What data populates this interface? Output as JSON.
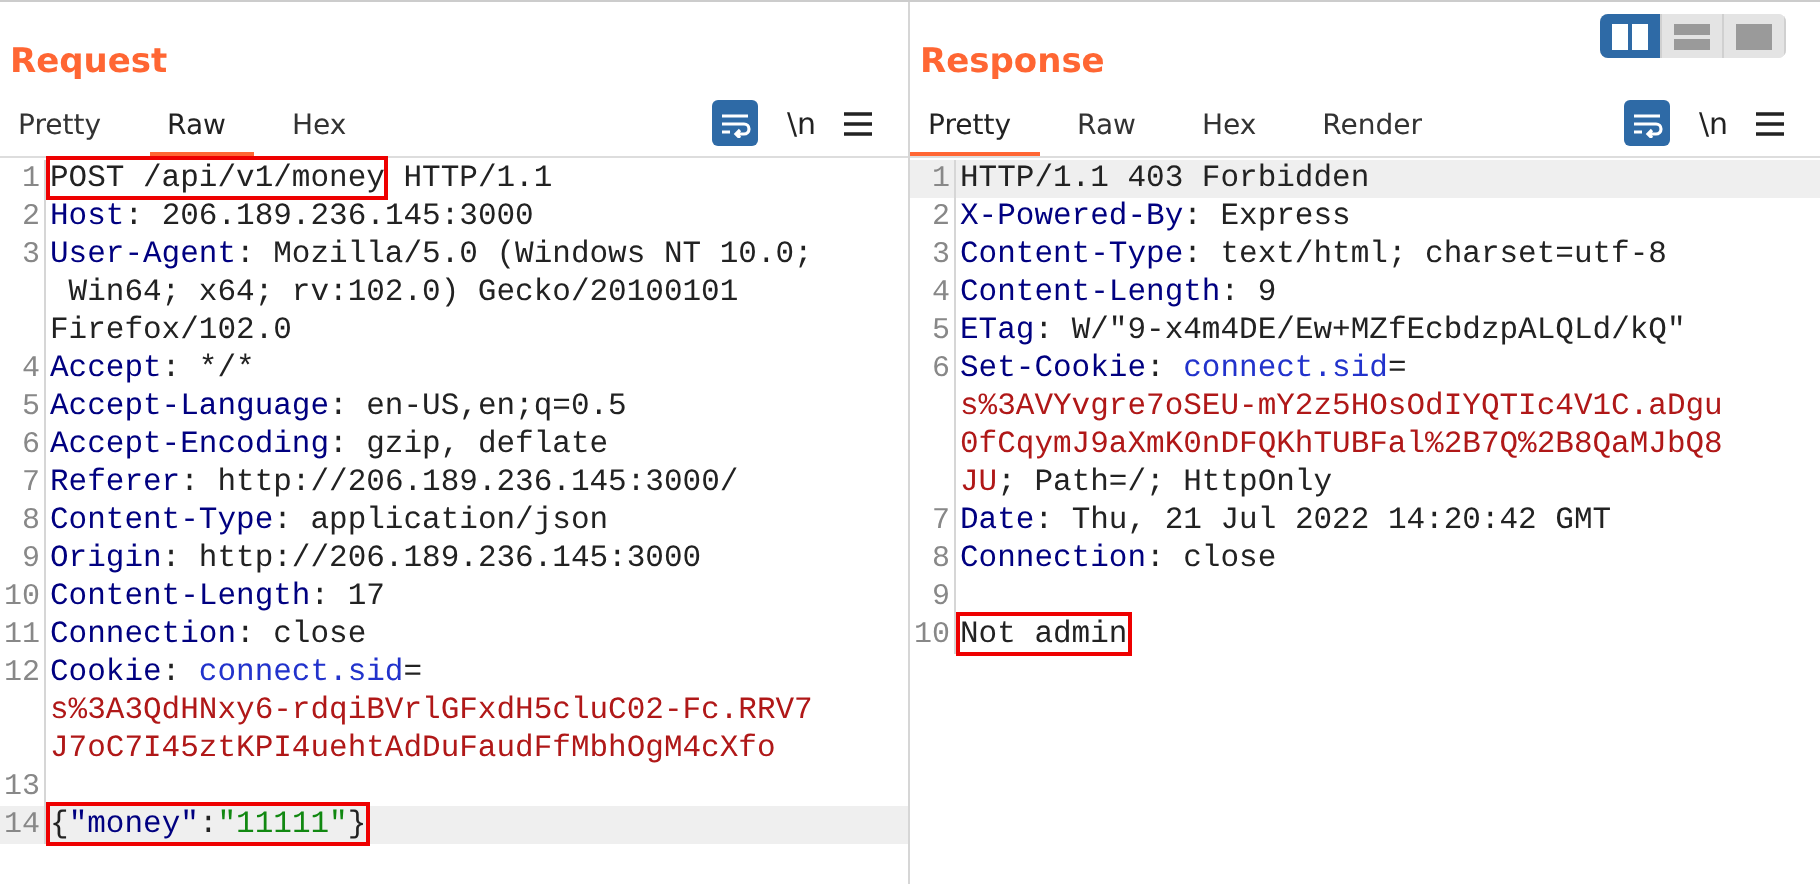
{
  "layout_toggle": [
    {
      "selected": true,
      "kind": "columns"
    },
    {
      "selected": false,
      "kind": "rows"
    },
    {
      "selected": false,
      "kind": "single"
    }
  ],
  "panels": [
    {
      "title": "Request",
      "tabs": [
        {
          "label": "Pretty",
          "selected": false
        },
        {
          "label": "Raw",
          "selected": true
        },
        {
          "label": "Hex",
          "selected": false
        }
      ],
      "tools": [
        {
          "kind": "wrap",
          "on": true
        },
        {
          "kind": "newline",
          "label": "\\n",
          "on": false
        },
        {
          "kind": "menu",
          "on": false
        }
      ],
      "lines": [
        {
          "number": "1",
          "current": false,
          "rows": [
            {
              "boxed": [
                {
                  "t": "POST /api/v1/money",
                  "kind": "plain"
                }
              ],
              "segments": [
                {
                  "t": " HTTP/1.1",
                  "kind": "plain"
                }
              ]
            }
          ]
        },
        {
          "number": "2",
          "current": false,
          "rows": [
            {
              "segments": [
                {
                  "t": "Host",
                  "kind": "key"
                },
                {
                  "t": ": 206.189.236.145:3000",
                  "kind": "plain"
                }
              ]
            }
          ]
        },
        {
          "number": "3",
          "current": false,
          "rows": [
            {
              "segments": [
                {
                  "t": "User-Agent",
                  "kind": "key"
                },
                {
                  "t": ": Mozilla/5.0 (Windows NT 10.0;",
                  "kind": "plain"
                }
              ]
            },
            {
              "segments": [
                {
                  "t": " Win64; x64; rv:102.0) Gecko/20100101",
                  "kind": "plain"
                }
              ]
            },
            {
              "segments": [
                {
                  "t": "Firefox/102.0",
                  "kind": "plain"
                }
              ]
            }
          ]
        },
        {
          "number": "4",
          "current": false,
          "rows": [
            {
              "segments": [
                {
                  "t": "Accept",
                  "kind": "key"
                },
                {
                  "t": ": */*",
                  "kind": "plain"
                }
              ]
            }
          ]
        },
        {
          "number": "5",
          "current": false,
          "rows": [
            {
              "segments": [
                {
                  "t": "Accept-Language",
                  "kind": "key"
                },
                {
                  "t": ": en-US,en;q=0.5",
                  "kind": "plain"
                }
              ]
            }
          ]
        },
        {
          "number": "6",
          "current": false,
          "rows": [
            {
              "segments": [
                {
                  "t": "Accept-Encoding",
                  "kind": "key"
                },
                {
                  "t": ": gzip, deflate",
                  "kind": "plain"
                }
              ]
            }
          ]
        },
        {
          "number": "7",
          "current": false,
          "rows": [
            {
              "segments": [
                {
                  "t": "Referer",
                  "kind": "key"
                },
                {
                  "t": ": http://206.189.236.145:3000/",
                  "kind": "plain"
                }
              ]
            }
          ]
        },
        {
          "number": "8",
          "current": false,
          "rows": [
            {
              "segments": [
                {
                  "t": "Content-Type",
                  "kind": "key"
                },
                {
                  "t": ": application/json",
                  "kind": "plain"
                }
              ]
            }
          ]
        },
        {
          "number": "9",
          "current": false,
          "rows": [
            {
              "segments": [
                {
                  "t": "Origin",
                  "kind": "key"
                },
                {
                  "t": ": http://206.189.236.145:3000",
                  "kind": "plain"
                }
              ]
            }
          ]
        },
        {
          "number": "10",
          "current": false,
          "rows": [
            {
              "segments": [
                {
                  "t": "Content-Length",
                  "kind": "key"
                },
                {
                  "t": ": 17",
                  "kind": "plain"
                }
              ]
            }
          ]
        },
        {
          "number": "11",
          "current": false,
          "rows": [
            {
              "segments": [
                {
                  "t": "Connection",
                  "kind": "key"
                },
                {
                  "t": ": close",
                  "kind": "plain"
                }
              ]
            }
          ]
        },
        {
          "number": "12",
          "current": false,
          "rows": [
            {
              "segments": [
                {
                  "t": "Cookie",
                  "kind": "key"
                },
                {
                  "t": ": ",
                  "kind": "plain"
                },
                {
                  "t": "connect.sid",
                  "kind": "attr"
                },
                {
                  "t": "=",
                  "kind": "plain"
                }
              ]
            },
            {
              "segments": [
                {
                  "t": "s%3A3QdHNxy6-rdqiBVrlGFxdH5cluC02-Fc.RRV7",
                  "kind": "cookie"
                }
              ]
            },
            {
              "segments": [
                {
                  "t": "J7oC7I45ztKPI4uehtAdDuFaudFfMbhOgM4cXfo",
                  "kind": "cookie"
                }
              ]
            }
          ]
        },
        {
          "number": "13",
          "current": false,
          "rows": [
            {
              "segments": []
            }
          ]
        },
        {
          "number": "14",
          "current": true,
          "rows": [
            {
              "boxed": [
                {
                  "t": "{",
                  "kind": "plain"
                },
                {
                  "t": "\"money\"",
                  "kind": "key"
                },
                {
                  "t": ":",
                  "kind": "plain"
                },
                {
                  "t": "\"11111\"",
                  "kind": "string"
                },
                {
                  "t": "}",
                  "kind": "plain"
                }
              ],
              "segments": []
            }
          ]
        }
      ]
    },
    {
      "title": "Response",
      "tabs": [
        {
          "label": "Pretty",
          "selected": true
        },
        {
          "label": "Raw",
          "selected": false
        },
        {
          "label": "Hex",
          "selected": false
        },
        {
          "label": "Render",
          "selected": false
        }
      ],
      "tools": [
        {
          "kind": "wrap",
          "on": true
        },
        {
          "kind": "newline",
          "label": "\\n",
          "on": false
        },
        {
          "kind": "menu",
          "on": false
        }
      ],
      "lines": [
        {
          "number": "1",
          "current": true,
          "rows": [
            {
              "segments": [
                {
                  "t": "HTTP/1.1 403 Forbidden",
                  "kind": "plain"
                }
              ]
            }
          ]
        },
        {
          "number": "2",
          "current": false,
          "rows": [
            {
              "segments": [
                {
                  "t": "X-Powered-By",
                  "kind": "key"
                },
                {
                  "t": ": Express",
                  "kind": "plain"
                }
              ]
            }
          ]
        },
        {
          "number": "3",
          "current": false,
          "rows": [
            {
              "segments": [
                {
                  "t": "Content-Type",
                  "kind": "key"
                },
                {
                  "t": ": text/html; charset=utf-8",
                  "kind": "plain"
                }
              ]
            }
          ]
        },
        {
          "number": "4",
          "current": false,
          "rows": [
            {
              "segments": [
                {
                  "t": "Content-Length",
                  "kind": "key"
                },
                {
                  "t": ": 9",
                  "kind": "plain"
                }
              ]
            }
          ]
        },
        {
          "number": "5",
          "current": false,
          "rows": [
            {
              "segments": [
                {
                  "t": "ETag",
                  "kind": "key"
                },
                {
                  "t": ": W/\"9-x4m4DE/Ew+MZfEcbdzpALQLd/kQ\"",
                  "kind": "plain"
                }
              ]
            }
          ]
        },
        {
          "number": "6",
          "current": false,
          "rows": [
            {
              "segments": [
                {
                  "t": "Set-Cookie",
                  "kind": "key"
                },
                {
                  "t": ": ",
                  "kind": "plain"
                },
                {
                  "t": "connect.sid",
                  "kind": "attr"
                },
                {
                  "t": "=",
                  "kind": "plain"
                }
              ]
            },
            {
              "segments": [
                {
                  "t": "s%3AVYvgre7oSEU-mY2z5HOsOdIYQTIc4V1C.aDgu",
                  "kind": "cookie"
                }
              ]
            },
            {
              "segments": [
                {
                  "t": "0fCqymJ9aXmK0nDFQKhTUBFal%2B7Q%2B8QaMJbQ8",
                  "kind": "cookie"
                }
              ]
            },
            {
              "segments": [
                {
                  "t": "JU",
                  "kind": "cookie"
                },
                {
                  "t": "; Path=/; HttpOnly",
                  "kind": "plain"
                }
              ]
            }
          ]
        },
        {
          "number": "7",
          "current": false,
          "rows": [
            {
              "segments": [
                {
                  "t": "Date",
                  "kind": "key"
                },
                {
                  "t": ": Thu, 21 Jul 2022 14:20:42 GMT",
                  "kind": "plain"
                }
              ]
            }
          ]
        },
        {
          "number": "8",
          "current": false,
          "rows": [
            {
              "segments": [
                {
                  "t": "Connection",
                  "kind": "key"
                },
                {
                  "t": ": close",
                  "kind": "plain"
                }
              ]
            }
          ]
        },
        {
          "number": "9",
          "current": false,
          "rows": [
            {
              "segments": []
            }
          ]
        },
        {
          "number": "10",
          "current": false,
          "rows": [
            {
              "boxed": [
                {
                  "t": "Not admin",
                  "kind": "plain"
                }
              ],
              "segments": []
            }
          ]
        }
      ]
    }
  ]
}
